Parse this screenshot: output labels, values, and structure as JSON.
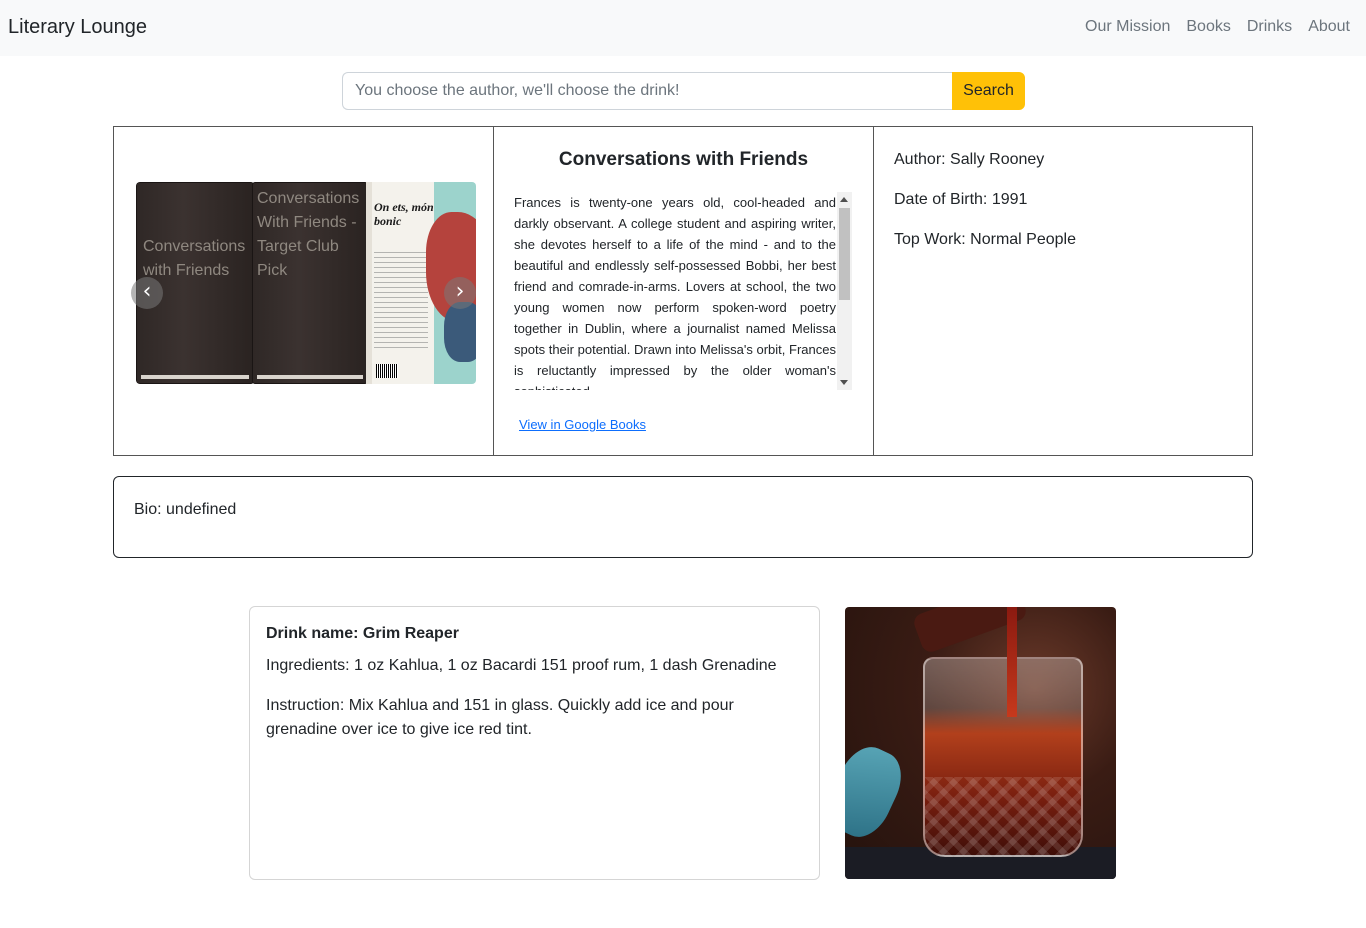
{
  "navbar": {
    "brand": "Literary Lounge",
    "links": [
      "Our Mission",
      "Books",
      "Drinks",
      "About"
    ]
  },
  "search": {
    "placeholder": "You choose the author, we'll choose the drink!",
    "button_label": "Search"
  },
  "book": {
    "carousel": {
      "slides": [
        "Conversations with Friends",
        "Conversations With Friends - Target Club Pick"
      ],
      "cover_title": "On ets, món bonic",
      "prev_icon": "chevron-left-icon",
      "next_icon": "chevron-right-icon"
    },
    "title": "Conversations with Friends",
    "description": "Frances is twenty-one years old, cool-headed and darkly observant. A college student and aspiring writer, she devotes herself to a life of the mind - and to the beautiful and endlessly self-possessed Bobbi, her best friend and comrade-in-arms. Lovers at school, the two young women now perform spoken-word poetry together in Dublin, where a journalist named Melissa spots their potential. Drawn into Melissa's orbit, Frances is reluctantly impressed by the older woman's sophisticated",
    "link_label": "View in Google Books"
  },
  "author": {
    "name_line": "Author: Sally Rooney",
    "dob_line": "Date of Birth: 1991",
    "top_work_line": "Top Work: Normal People"
  },
  "bio": {
    "text": "Bio: undefined"
  },
  "drink": {
    "name": "Drink name: Grim Reaper",
    "ingredients": "Ingredients: 1 oz Kahlua, 1 oz Bacardi 151 proof rum, 1 dash Grenadine",
    "instruction": "Instruction: Mix Kahlua and 151 in glass. Quickly add ice and pour grenadine over ice to give ice red tint."
  },
  "colors": {
    "navbar_bg": "#f8f9fa",
    "search_button": "#ffc107",
    "link": "#0d6efd"
  }
}
